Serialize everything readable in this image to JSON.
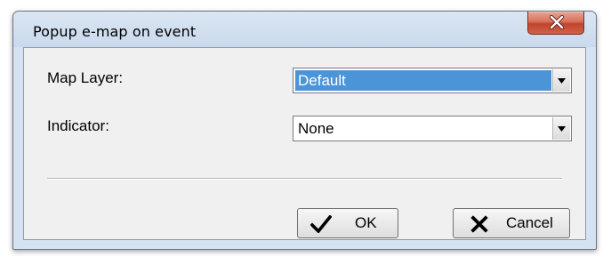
{
  "window": {
    "title": "Popup e-map on event"
  },
  "form": {
    "map_layer": {
      "label": "Map Layer:",
      "value": "Default"
    },
    "indicator": {
      "label": "Indicator:",
      "value": "None"
    }
  },
  "buttons": {
    "ok_label": "OK",
    "cancel_label": "Cancel"
  },
  "icons": {
    "close": "close-icon",
    "ok": "checkmark-icon",
    "cancel": "x-mark-icon",
    "dropdown": "dropdown-arrow-icon"
  },
  "colors": {
    "selection": "#4c94d8",
    "close_button": "#c3432c"
  }
}
